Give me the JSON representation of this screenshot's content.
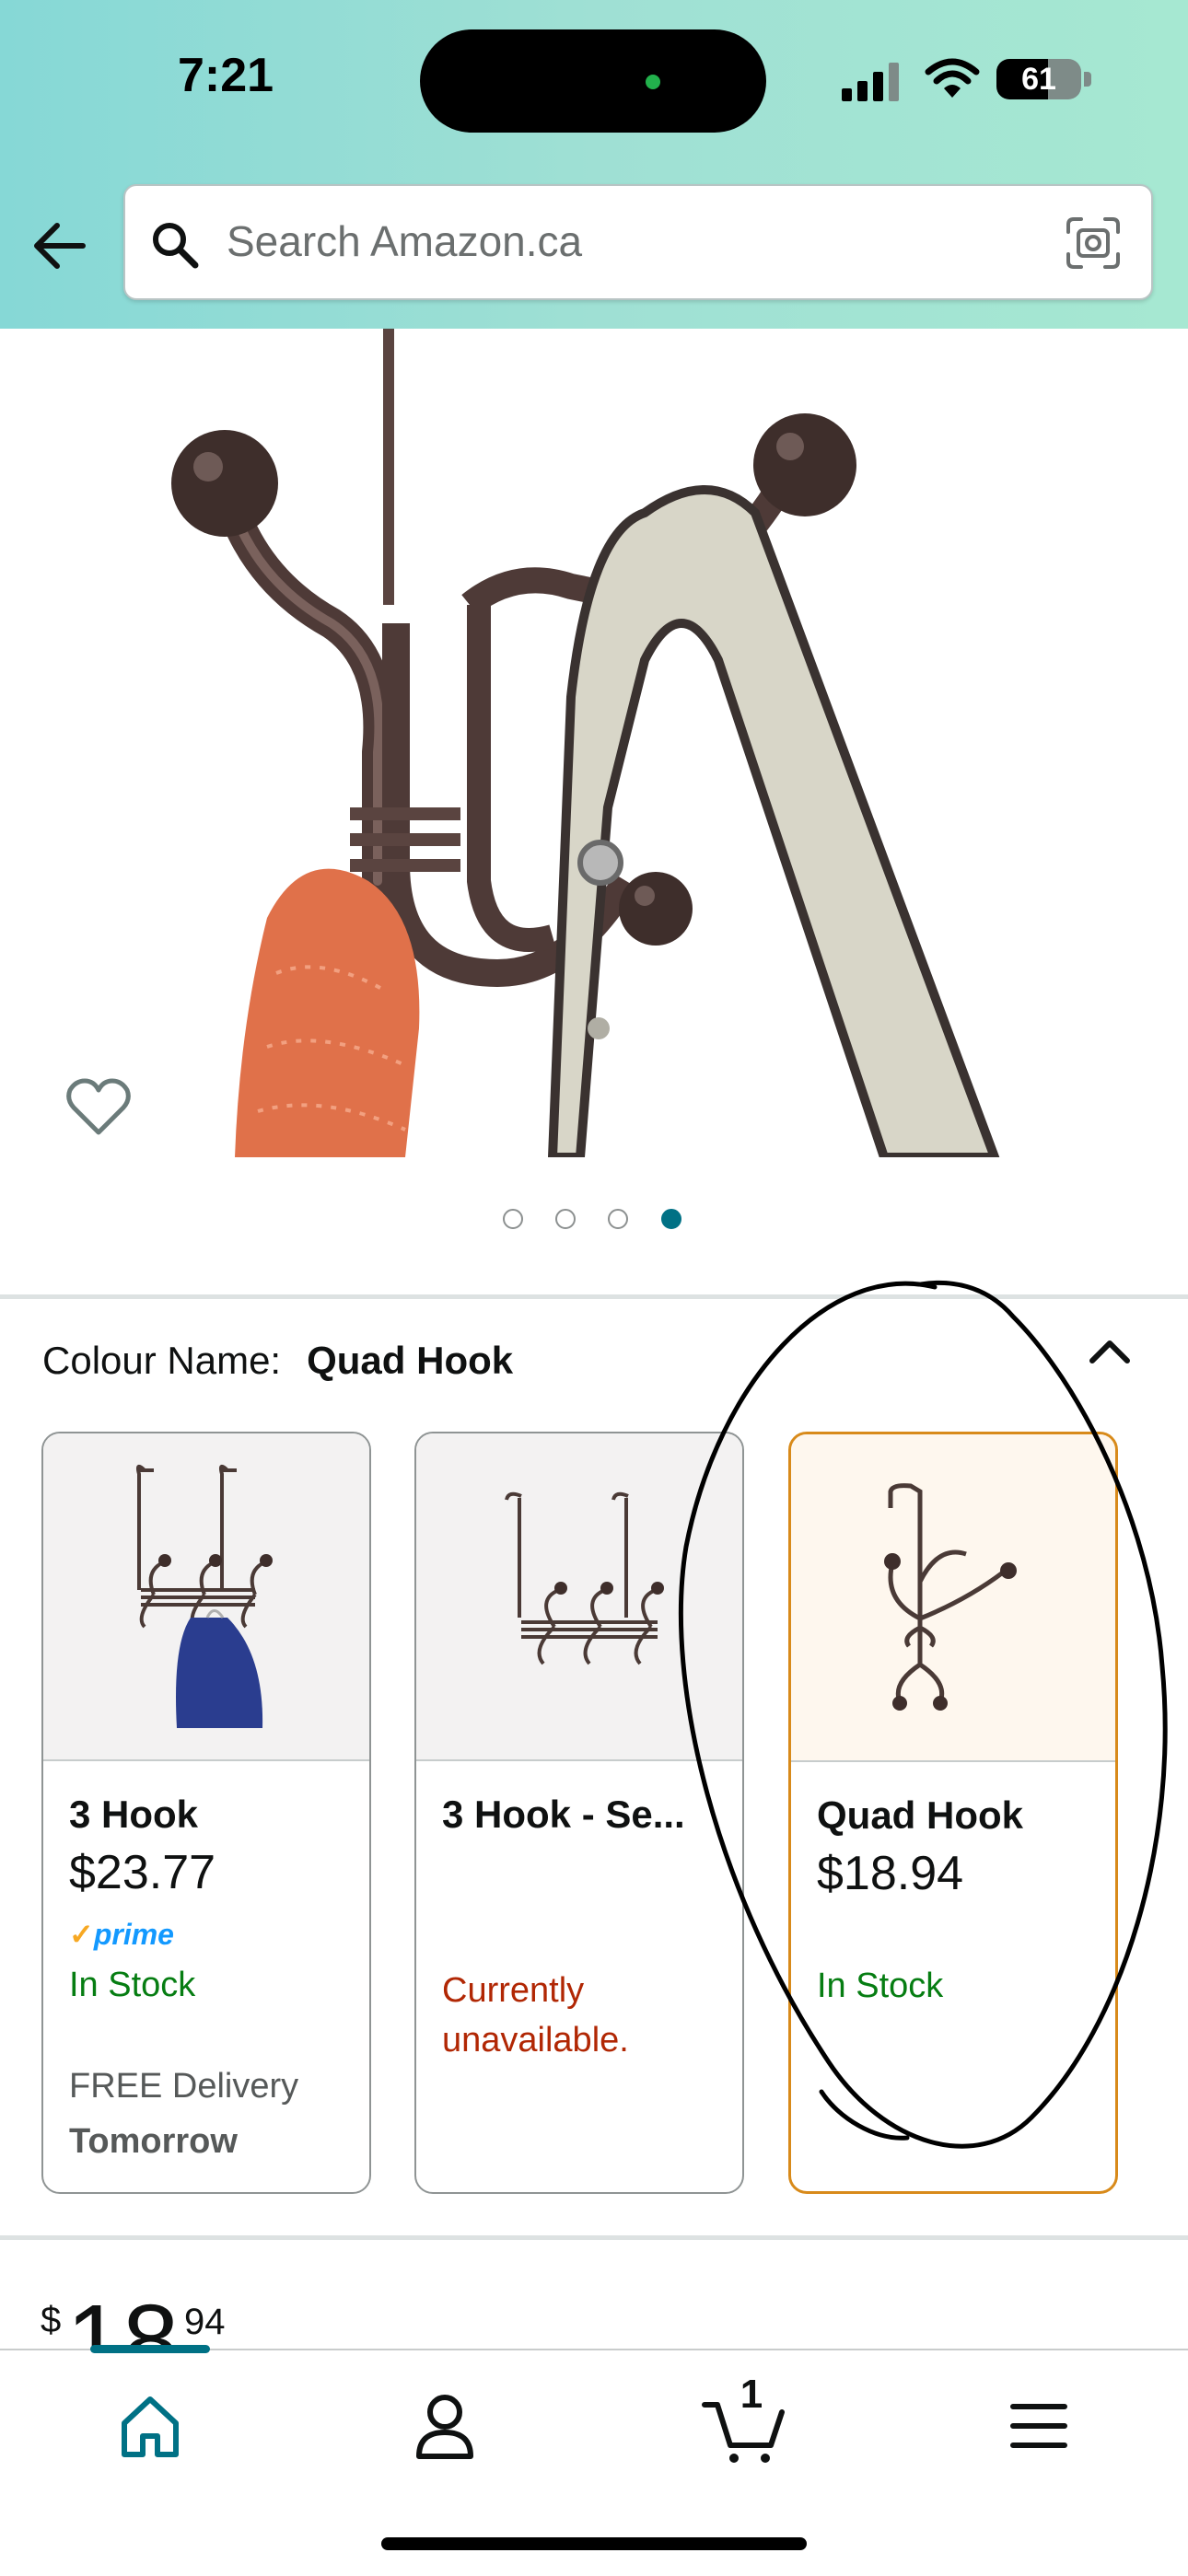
{
  "status_bar": {
    "time": "7:21",
    "battery": "61"
  },
  "header": {
    "search_placeholder": "Search Amazon.ca"
  },
  "icons": {
    "back": "arrow-left-icon",
    "search": "search-icon",
    "camera": "camera-scan-icon",
    "wishlist": "heart-icon",
    "collapse": "chevron-up-icon",
    "home": "home-icon",
    "account": "person-icon",
    "cart": "cart-icon",
    "menu": "hamburger-menu-icon"
  },
  "gallery": {
    "dot_count": 4,
    "active_index": 3
  },
  "colour": {
    "label": "Colour Name:",
    "selected": "Quad Hook"
  },
  "variants": [
    {
      "name": "3 Hook",
      "price": "$23.77",
      "prime": "prime",
      "availability": "In Stock",
      "delivery": "FREE Delivery",
      "delivery_day": "Tomorrow"
    },
    {
      "name": "3 Hook - Se...",
      "availability": "Currently unavailable."
    },
    {
      "name": "Quad Hook",
      "price": "$18.94",
      "availability": "In Stock"
    }
  ],
  "price": {
    "symbol": "$",
    "whole": "18",
    "fraction": "94"
  },
  "cart": {
    "count": "1"
  },
  "colors": {
    "accent_teal": "#007185",
    "in_stock_green": "#067d12",
    "unavailable_red": "#b12704",
    "selected_border": "#d88a1a"
  }
}
